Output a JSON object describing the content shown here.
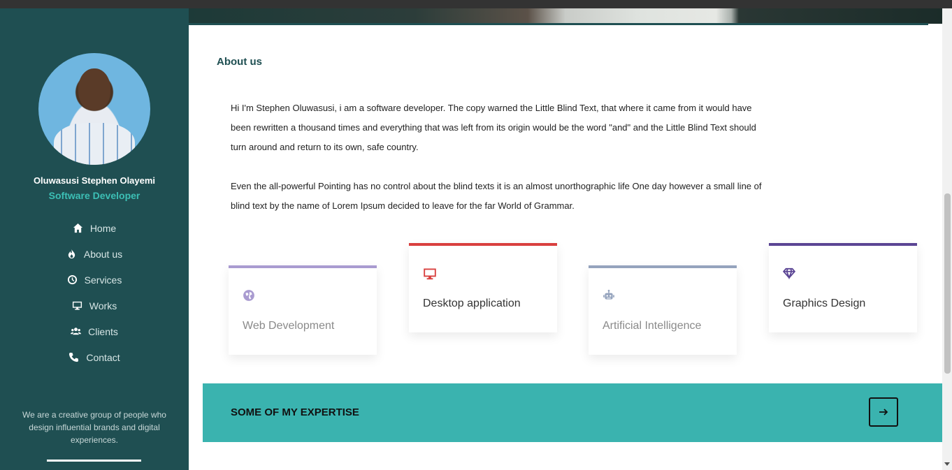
{
  "sidebar": {
    "name": "Oluwasusi Stephen Olayemi",
    "role": "Software Developer",
    "nav": [
      {
        "label": "Home",
        "icon": "home-icon"
      },
      {
        "label": "About us",
        "icon": "fire-icon"
      },
      {
        "label": "Services",
        "icon": "clock-icon"
      },
      {
        "label": "Works",
        "icon": "desktop-icon"
      },
      {
        "label": "Clients",
        "icon": "users-icon"
      },
      {
        "label": "Contact",
        "icon": "phone-icon"
      }
    ],
    "tagline": "We are a creative group of people who design influential brands and digital experiences."
  },
  "about": {
    "title": "About us",
    "paragraph1": "Hi I'm Stephen Oluwasusi, i am a software developer. The copy warned the Little Blind Text, that where it came from it would have been rewritten a thousand times and everything that was left from its origin would be the word \"and\" and the Little Blind Text should turn around and return to its own, safe country.",
    "paragraph2": "Even the all-powerful Pointing has no control about the blind texts it is an almost unorthographic life One day however a small line of blind text by the name of Lorem Ipsum decided to leave for the far World of Grammar."
  },
  "cards": [
    {
      "label": "Web Development",
      "icon": "globe-icon",
      "color": "#a99bd0"
    },
    {
      "label": "Desktop application",
      "icon": "desktop-icon",
      "color": "#d9403f"
    },
    {
      "label": "Artificial Intelligence",
      "icon": "robot-icon",
      "color": "#95a3bd"
    },
    {
      "label": "Graphics Design",
      "icon": "diamond-icon",
      "color": "#5b4594"
    }
  ],
  "expertise": {
    "title": "SOME OF MY EXPERTISE",
    "button_icon": "arrow-right-icon"
  },
  "colors": {
    "sidebar": "#1f4f52",
    "accent": "#3ab3af",
    "role": "#3cbfb5"
  }
}
